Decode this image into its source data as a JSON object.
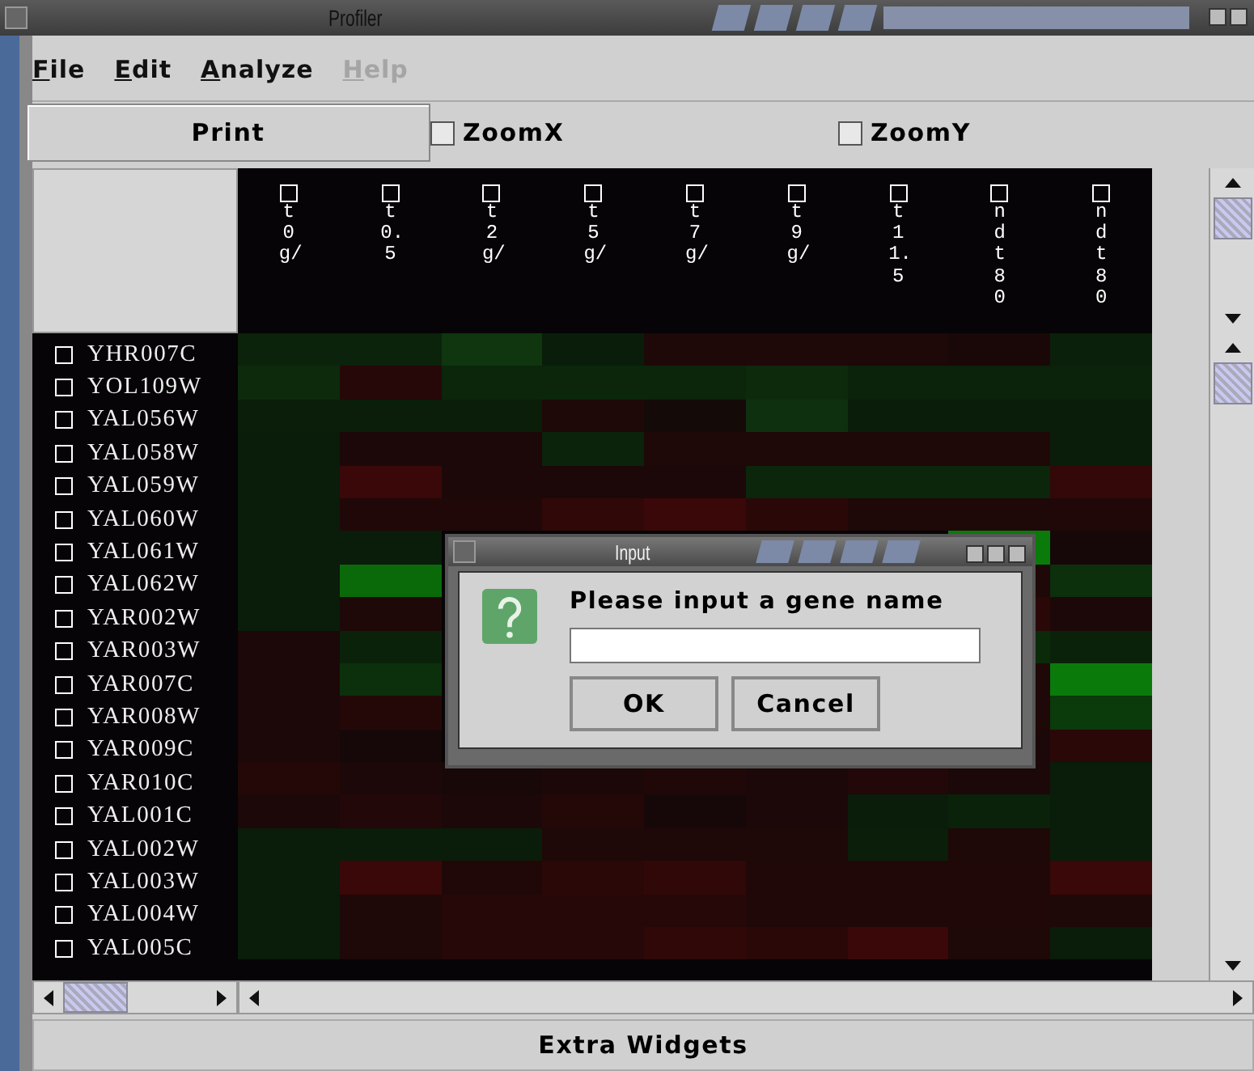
{
  "window": {
    "title": "Profiler"
  },
  "menu": [
    {
      "label": "File",
      "disabled": false
    },
    {
      "label": "Edit",
      "disabled": false
    },
    {
      "label": "Analyze",
      "disabled": false
    },
    {
      "label": "Help",
      "disabled": true
    }
  ],
  "toolbar": {
    "print": "Print",
    "zoom_x": {
      "label": "ZoomX",
      "checked": false
    },
    "zoom_y": {
      "label": "ZoomY",
      "checked": false
    }
  },
  "columns": [
    {
      "label": "t0 g/",
      "checked": false
    },
    {
      "label": "t0.5",
      "checked": false
    },
    {
      "label": "t2 g/",
      "checked": false
    },
    {
      "label": "t5 g/",
      "checked": false
    },
    {
      "label": "t7 g/",
      "checked": false
    },
    {
      "label": "t9 g/",
      "checked": false
    },
    {
      "label": "t11.5",
      "checked": false
    },
    {
      "label": "ndt80",
      "checked": false
    },
    {
      "label": "ndt80",
      "checked": false
    }
  ],
  "rows": [
    {
      "gene": "YHR007C",
      "checked": false,
      "cells": [
        {
          "color": "#0b220b"
        },
        {
          "color": "#0b220b"
        },
        {
          "color": "#0f360f"
        },
        {
          "color": "#0a1c0a"
        },
        {
          "color": "#1e0808"
        },
        {
          "color": "#1e0808"
        },
        {
          "color": "#1e0808"
        },
        {
          "color": "#1a0808"
        },
        {
          "color": "#0a200a"
        }
      ]
    },
    {
      "gene": "YOL109W",
      "checked": false,
      "cells": [
        {
          "color": "#0d2a0d"
        },
        {
          "color": "#260808"
        },
        {
          "color": "#0b260b"
        },
        {
          "color": "#0b260b"
        },
        {
          "color": "#0b260b"
        },
        {
          "color": "#0d2a0d"
        },
        {
          "color": "#0b220b"
        },
        {
          "color": "#0b220b"
        },
        {
          "color": "#0b220b"
        }
      ]
    },
    {
      "gene": "YAL056W",
      "checked": false,
      "cells": [
        {
          "color": "#0a1e0a"
        },
        {
          "color": "#0a1e0a"
        },
        {
          "color": "#0a1e0a"
        },
        {
          "color": "#1e0808"
        },
        {
          "color": "#140a08"
        },
        {
          "color": "#0f300f"
        },
        {
          "color": "#0a1c0a"
        },
        {
          "color": "#0a1c0a"
        },
        {
          "color": "#0a1c0a"
        }
      ]
    },
    {
      "gene": "YAL058W",
      "checked": false,
      "cells": [
        {
          "color": "#0a1c0a"
        },
        {
          "color": "#1c0808"
        },
        {
          "color": "#1c0808"
        },
        {
          "color": "#0b220b"
        },
        {
          "color": "#1e0808"
        },
        {
          "color": "#1e0808"
        },
        {
          "color": "#1e0808"
        },
        {
          "color": "#1e0808"
        },
        {
          "color": "#0a1c0a"
        }
      ]
    },
    {
      "gene": "YAL059W",
      "checked": false,
      "cells": [
        {
          "color": "#0a1c0a"
        },
        {
          "color": "#3a0808"
        },
        {
          "color": "#1c0808"
        },
        {
          "color": "#1c0808"
        },
        {
          "color": "#1c0808"
        },
        {
          "color": "#0b260b"
        },
        {
          "color": "#0b260b"
        },
        {
          "color": "#0b260b"
        },
        {
          "color": "#340808"
        }
      ]
    },
    {
      "gene": "YAL060W",
      "checked": false,
      "cells": [
        {
          "color": "#0a1c0a"
        },
        {
          "color": "#200808"
        },
        {
          "color": "#200808"
        },
        {
          "color": "#300808"
        },
        {
          "color": "#3a0808"
        },
        {
          "color": "#2a0808"
        },
        {
          "color": "#1e0808"
        },
        {
          "color": "#1e0808"
        },
        {
          "color": "#200808"
        }
      ]
    },
    {
      "gene": "YAL061W",
      "checked": false,
      "cells": [
        {
          "color": "#0a1c0a"
        },
        {
          "color": "#0a1c0a"
        },
        null,
        null,
        null,
        null,
        null,
        {
          "color": "#0a7a0a"
        },
        {
          "color": "#160808"
        }
      ]
    },
    {
      "gene": "YAL062W",
      "checked": false,
      "cells": [
        {
          "color": "#0a1c0a"
        },
        {
          "color": "#0a6a0a"
        },
        null,
        null,
        null,
        null,
        null,
        {
          "color": "#1e0808"
        },
        {
          "color": "#0b300b"
        }
      ]
    },
    {
      "gene": "YAR002W",
      "checked": false,
      "cells": [
        {
          "color": "#0a1c0a"
        },
        {
          "color": "#1e0808"
        },
        null,
        null,
        null,
        null,
        null,
        {
          "color": "#2a0808"
        },
        {
          "color": "#1c0808"
        }
      ]
    },
    {
      "gene": "YAR003W",
      "checked": false,
      "cells": [
        {
          "color": "#1c0808"
        },
        {
          "color": "#0a220a"
        },
        null,
        null,
        null,
        null,
        null,
        {
          "color": "#0a2a0a"
        },
        {
          "color": "#0a220a"
        }
      ]
    },
    {
      "gene": "YAR007C",
      "checked": false,
      "cells": [
        {
          "color": "#1c0808"
        },
        {
          "color": "#0b300b"
        },
        null,
        null,
        null,
        null,
        null,
        {
          "color": "#1e0808"
        },
        {
          "color": "#0a7a0a"
        }
      ]
    },
    {
      "gene": "YAR008W",
      "checked": false,
      "cells": [
        {
          "color": "#1c0808"
        },
        {
          "color": "#240808"
        },
        null,
        null,
        null,
        null,
        null,
        {
          "color": "#1e0808"
        },
        {
          "color": "#0b3a0b"
        }
      ]
    },
    {
      "gene": "YAR009C",
      "checked": false,
      "cells": [
        {
          "color": "#1c0808"
        },
        {
          "color": "#160808"
        },
        null,
        null,
        null,
        null,
        null,
        {
          "color": "#1c0808"
        },
        {
          "color": "#2a0808"
        }
      ]
    },
    {
      "gene": "YAR010C",
      "checked": false,
      "cells": [
        {
          "color": "#240808"
        },
        {
          "color": "#1c0808"
        },
        {
          "color": "#180808"
        },
        {
          "color": "#1c0808"
        },
        {
          "color": "#200808"
        },
        {
          "color": "#1c0808"
        },
        {
          "color": "#220808"
        },
        {
          "color": "#1c0808"
        },
        {
          "color": "#0a1c0a"
        }
      ]
    },
    {
      "gene": "YAL001C",
      "checked": false,
      "cells": [
        {
          "color": "#1c0808"
        },
        {
          "color": "#220808"
        },
        {
          "color": "#1c0808"
        },
        {
          "color": "#240808"
        },
        {
          "color": "#160808"
        },
        {
          "color": "#1c0808"
        },
        {
          "color": "#0a1c0a"
        },
        {
          "color": "#0a220a"
        },
        {
          "color": "#0a1c0a"
        }
      ]
    },
    {
      "gene": "YAL002W",
      "checked": false,
      "cells": [
        {
          "color": "#0a1c0a"
        },
        {
          "color": "#0a1c0a"
        },
        {
          "color": "#0a1c0a"
        },
        {
          "color": "#1e0808"
        },
        {
          "color": "#1e0808"
        },
        {
          "color": "#1e0808"
        },
        {
          "color": "#0a1e0a"
        },
        {
          "color": "#1e0808"
        },
        {
          "color": "#0a1c0a"
        }
      ]
    },
    {
      "gene": "YAL003W",
      "checked": false,
      "cells": [
        {
          "color": "#0a1c0a"
        },
        {
          "color": "#3a0808"
        },
        {
          "color": "#200808"
        },
        {
          "color": "#2a0808"
        },
        {
          "color": "#300808"
        },
        {
          "color": "#200808"
        },
        {
          "color": "#200808"
        },
        {
          "color": "#200808"
        },
        {
          "color": "#3a0808"
        }
      ]
    },
    {
      "gene": "YAL004W",
      "checked": false,
      "cells": [
        {
          "color": "#0a1c0a"
        },
        {
          "color": "#1e0808"
        },
        {
          "color": "#260808"
        },
        {
          "color": "#260808"
        },
        {
          "color": "#260808"
        },
        {
          "color": "#200808"
        },
        {
          "color": "#200808"
        },
        {
          "color": "#200808"
        },
        {
          "color": "#1e0808"
        }
      ]
    },
    {
      "gene": "YAL005C",
      "checked": false,
      "cells": [
        {
          "color": "#0a1c0a"
        },
        {
          "color": "#1e0808"
        },
        {
          "color": "#260808"
        },
        {
          "color": "#260808"
        },
        {
          "color": "#300808"
        },
        {
          "color": "#2a0808"
        },
        {
          "color": "#3a0808"
        },
        {
          "color": "#1e0808"
        },
        {
          "color": "#0a1c0a"
        }
      ]
    }
  ],
  "bottom_button": "Extra Widgets",
  "dialog": {
    "title": "Input",
    "message": "Please input a gene name",
    "ok": "OK",
    "cancel": "Cancel"
  }
}
